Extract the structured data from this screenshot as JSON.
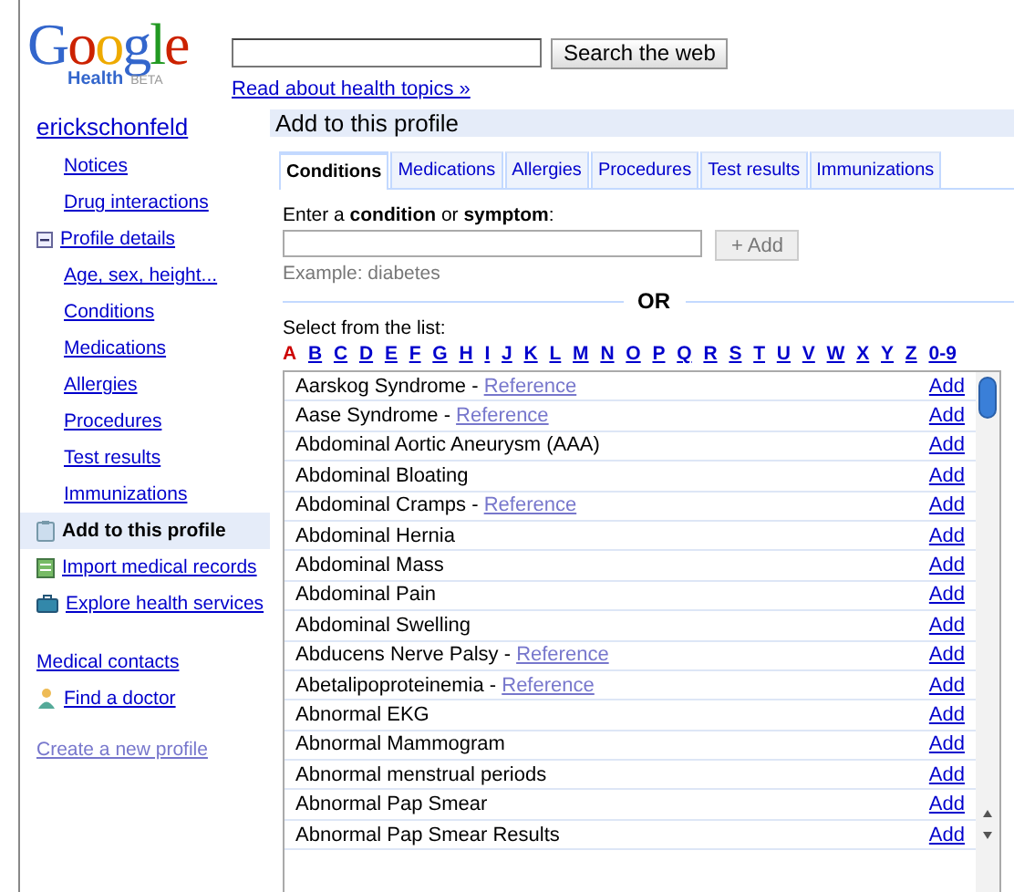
{
  "logo": {
    "word": "Google",
    "product": "Health",
    "badge": "BETA"
  },
  "search": {
    "button": "Search the web",
    "link": "Read about health topics »"
  },
  "sidebar": {
    "user": "erickschonfeld",
    "items": [
      {
        "label": "Notices",
        "kind": "sub",
        "selected": false
      },
      {
        "label": "Drug interactions",
        "kind": "sub",
        "selected": false
      },
      {
        "label": "Profile details",
        "kind": "collapse",
        "selected": false
      },
      {
        "label": "Age, sex, height...",
        "kind": "sub",
        "selected": false
      },
      {
        "label": "Conditions",
        "kind": "sub",
        "selected": false
      },
      {
        "label": "Medications",
        "kind": "sub",
        "selected": false
      },
      {
        "label": "Allergies",
        "kind": "sub",
        "selected": false
      },
      {
        "label": "Procedures",
        "kind": "sub",
        "selected": false
      },
      {
        "label": "Test results",
        "kind": "sub",
        "selected": false
      },
      {
        "label": "Immunizations",
        "kind": "sub",
        "selected": false
      },
      {
        "label": "Add to this profile",
        "kind": "clipboard",
        "selected": true
      },
      {
        "label": "Import medical records",
        "kind": "records",
        "selected": false
      },
      {
        "label": "Explore health services",
        "kind": "services",
        "selected": false
      },
      {
        "label": "Medical contacts",
        "kind": "plain",
        "selected": false
      },
      {
        "label": "Find a doctor",
        "kind": "doctor",
        "selected": false
      }
    ],
    "create": "Create a new profile"
  },
  "panel": {
    "title": "Add to this profile",
    "tabs": [
      {
        "label": "Conditions",
        "selected": true
      },
      {
        "label": "Medications",
        "selected": false
      },
      {
        "label": "Allergies",
        "selected": false
      },
      {
        "label": "Procedures",
        "selected": false
      },
      {
        "label": "Test results",
        "selected": false
      },
      {
        "label": "Immunizations",
        "selected": false
      }
    ],
    "prompt": "Enter a **condition** or **symptom**:",
    "add_button": "+ Add",
    "example": "Example: diabetes",
    "or": "OR",
    "select_label": "Select from the list:",
    "letters": [
      {
        "label": "A",
        "selected": true
      },
      {
        "label": "B",
        "selected": false
      },
      {
        "label": "C",
        "selected": false
      },
      {
        "label": "D",
        "selected": false
      },
      {
        "label": "E",
        "selected": false
      },
      {
        "label": "F",
        "selected": false
      },
      {
        "label": "G",
        "selected": false
      },
      {
        "label": "H",
        "selected": false
      },
      {
        "label": "I",
        "selected": false
      },
      {
        "label": "J",
        "selected": false
      },
      {
        "label": "K",
        "selected": false
      },
      {
        "label": "L",
        "selected": false
      },
      {
        "label": "M",
        "selected": false
      },
      {
        "label": "N",
        "selected": false
      },
      {
        "label": "O",
        "selected": false
      },
      {
        "label": "P",
        "selected": false
      },
      {
        "label": "Q",
        "selected": false
      },
      {
        "label": "R",
        "selected": false
      },
      {
        "label": "S",
        "selected": false
      },
      {
        "label": "T",
        "selected": false
      },
      {
        "label": "U",
        "selected": false
      },
      {
        "label": "V",
        "selected": false
      },
      {
        "label": "W",
        "selected": false
      },
      {
        "label": "X",
        "selected": false
      },
      {
        "label": "Y",
        "selected": false
      },
      {
        "label": "Z",
        "selected": false
      },
      {
        "label": "0-9",
        "selected": false
      }
    ],
    "rows": [
      {
        "name": "Aarskog Syndrome - ",
        "reference": "Reference",
        "action": "Add"
      },
      {
        "name": "Aase Syndrome - ",
        "reference": "Reference",
        "action": "Add"
      },
      {
        "name": "Abdominal Aortic Aneurysm (AAA)",
        "action": "Add"
      },
      {
        "name": "Abdominal Bloating",
        "action": "Add"
      },
      {
        "name": "Abdominal Cramps - ",
        "reference": "Reference",
        "action": "Add"
      },
      {
        "name": "Abdominal Hernia",
        "action": "Add"
      },
      {
        "name": "Abdominal Mass",
        "action": "Add"
      },
      {
        "name": "Abdominal Pain",
        "action": "Add"
      },
      {
        "name": "Abdominal Swelling",
        "action": "Add"
      },
      {
        "name": "Abducens Nerve Palsy - ",
        "reference": "Reference",
        "action": "Add"
      },
      {
        "name": "Abetalipoproteinemia - ",
        "reference": "Reference",
        "action": "Add"
      },
      {
        "name": "Abnormal EKG",
        "action": "Add"
      },
      {
        "name": "Abnormal Mammogram",
        "action": "Add"
      },
      {
        "name": "Abnormal menstrual periods",
        "action": "Add"
      },
      {
        "name": "Abnormal Pap Smear",
        "action": "Add"
      },
      {
        "name": "Abnormal Pap Smear Results",
        "action": "Add"
      }
    ]
  }
}
